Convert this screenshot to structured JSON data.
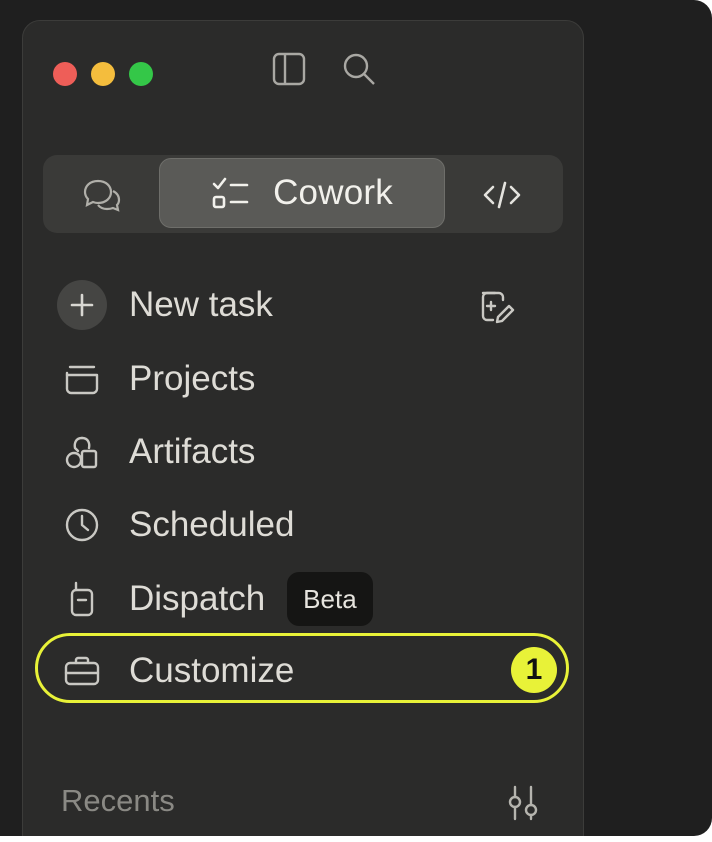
{
  "window": {
    "controls": [
      "close",
      "minimize",
      "zoom"
    ],
    "sidebar_toggle_icon": "sidebar-icon",
    "search_icon": "search-icon"
  },
  "mode_switcher": {
    "modes": [
      {
        "id": "chat",
        "icon": "chat-bubbles-icon",
        "label": ""
      },
      {
        "id": "cowork",
        "icon": "checklist-icon",
        "label": "Cowork",
        "selected": true
      },
      {
        "id": "code",
        "icon": "code-icon",
        "label": ""
      }
    ]
  },
  "nav": {
    "new_task": "New task",
    "projects": "Projects",
    "artifacts": "Artifacts",
    "scheduled": "Scheduled",
    "dispatch": "Dispatch",
    "dispatch_badge": "Beta",
    "customize": "Customize"
  },
  "annotation": {
    "step_number": "1",
    "highlight_color": "#e8f238"
  },
  "recents": {
    "label": "Recents"
  },
  "colors": {
    "background": "#1f1f1f",
    "panel": "#2b2b2a",
    "selected_segment": "#5a5a57",
    "text": "#dedcd6"
  }
}
